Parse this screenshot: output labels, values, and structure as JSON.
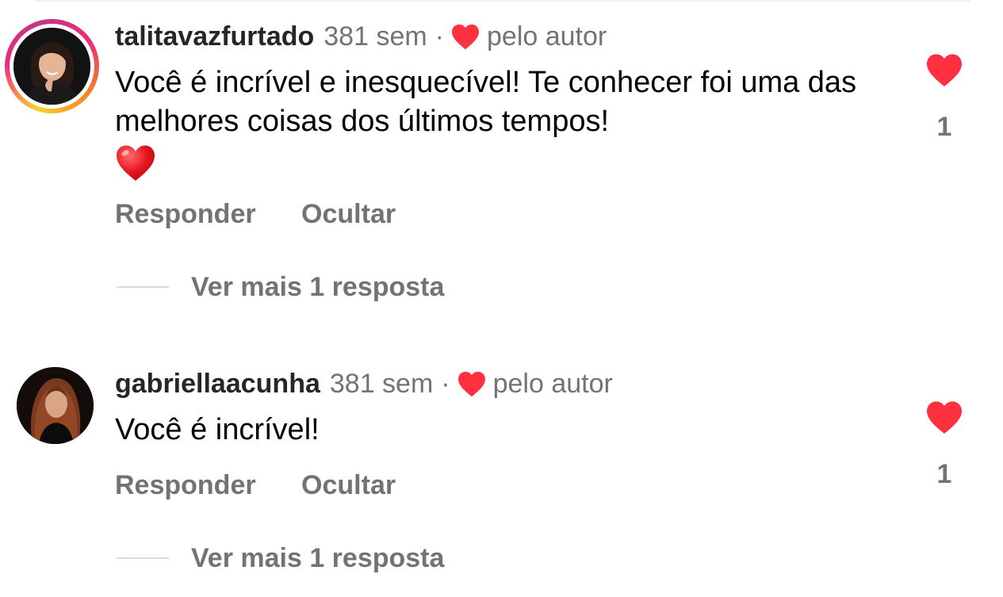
{
  "comments": [
    {
      "username": "talitavazfurtado",
      "time": "381 sem",
      "separator": "·",
      "author_like_label": "pelo autor",
      "text": "Você é incrível e inesquecível! Te conhecer foi uma das melhores coisas dos últimos tempos!",
      "emoji": "red-heart",
      "reply_label": "Responder",
      "hide_label": "Ocultar",
      "view_replies_label": "Ver mais 1 resposta",
      "like_count": "1",
      "like_icon": "heart-filled-icon",
      "avatar_story_ring": true
    },
    {
      "username": "gabriellaacunha",
      "time": "381 sem",
      "separator": "·",
      "author_like_label": "pelo autor",
      "text": "Você é incrível!",
      "reply_label": "Responder",
      "hide_label": "Ocultar",
      "view_replies_label": "Ver mais 1 resposta",
      "like_count": "1",
      "like_icon": "heart-filled-icon",
      "avatar_story_ring": false
    }
  ],
  "colors": {
    "heart_red": "#ff3040",
    "secondary_text": "#737373",
    "username_text": "#262626",
    "divider": "#dbdbdb"
  }
}
